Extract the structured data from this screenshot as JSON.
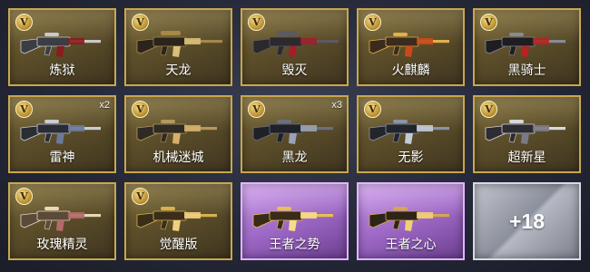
{
  "items": [
    {
      "name": "炼狱",
      "badge": "V",
      "count": "",
      "theme": "gold",
      "colors": {
        "body": "#3a3d44",
        "accent": "#c9c9c9",
        "trim": "#8a1c1c"
      }
    },
    {
      "name": "天龙",
      "badge": "V",
      "count": "",
      "theme": "gold",
      "colors": {
        "body": "#2b241c",
        "accent": "#a5884a",
        "trim": "#d8c07a"
      }
    },
    {
      "name": "毁灭",
      "badge": "V",
      "count": "",
      "theme": "gold",
      "colors": {
        "body": "#2a2a2e",
        "accent": "#5a5a62",
        "trim": "#a01f2a"
      }
    },
    {
      "name": "火麒麟",
      "badge": "V",
      "count": "",
      "theme": "gold",
      "colors": {
        "body": "#3b2a1e",
        "accent": "#e0b04a",
        "trim": "#c84a1a"
      }
    },
    {
      "name": "黑骑士",
      "badge": "V",
      "count": "",
      "theme": "gold",
      "colors": {
        "body": "#1e1e22",
        "accent": "#8a8a92",
        "trim": "#b52323"
      }
    },
    {
      "name": "雷神",
      "badge": "V",
      "count": "x2",
      "theme": "gold",
      "colors": {
        "body": "#2a2d33",
        "accent": "#c8ccd4",
        "trim": "#6a7a9a"
      }
    },
    {
      "name": "机械迷城",
      "badge": "V",
      "count": "",
      "theme": "gold",
      "colors": {
        "body": "#2f2a24",
        "accent": "#b49860",
        "trim": "#d4b06a"
      }
    },
    {
      "name": "黑龙",
      "badge": "V",
      "count": "x3",
      "theme": "gold",
      "colors": {
        "body": "#1f2128",
        "accent": "#6a7080",
        "trim": "#9aa2b4"
      }
    },
    {
      "name": "无影",
      "badge": "V",
      "count": "",
      "theme": "gold",
      "colors": {
        "body": "#22252c",
        "accent": "#8a93a8",
        "trim": "#c3cad8"
      }
    },
    {
      "name": "超新星",
      "badge": "V",
      "count": "",
      "theme": "gold",
      "colors": {
        "body": "#2c2c32",
        "accent": "#d8d8dc",
        "trim": "#7a7a86"
      }
    },
    {
      "name": "玫瑰精灵",
      "badge": "V",
      "count": "",
      "theme": "gold",
      "colors": {
        "body": "#5a4a3a",
        "accent": "#e8d8b8",
        "trim": "#b56a6a"
      }
    },
    {
      "name": "觉醒版",
      "badge": "V",
      "count": "",
      "theme": "gold",
      "colors": {
        "body": "#3a2e1a",
        "accent": "#d8b050",
        "trim": "#f0d080"
      }
    },
    {
      "name": "王者之势",
      "badge": "",
      "count": "",
      "theme": "purple",
      "colors": {
        "body": "#3a2a18",
        "accent": "#e8c050",
        "trim": "#f6dc8a"
      }
    },
    {
      "name": "王者之心",
      "badge": "",
      "count": "",
      "theme": "purple",
      "colors": {
        "body": "#2e2418",
        "accent": "#d4a84a",
        "trim": "#f0d078"
      }
    }
  ],
  "more": {
    "label": "+18"
  }
}
